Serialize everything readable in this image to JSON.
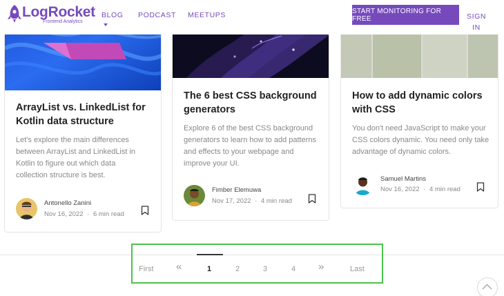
{
  "header": {
    "logo_text": "LogRocket",
    "logo_subtitle": "Frontend Analytics",
    "nav": [
      "BLOG",
      "PODCAST",
      "MEETUPS"
    ],
    "cta_label": "START MONITORING FOR FREE",
    "signin_line1": "SIGN",
    "signin_line2": "IN",
    "brand_color": "#764abc"
  },
  "cards": [
    {
      "title_line1": "ArrayList vs. LinkedList for",
      "title_line2": "Kotlin data structure",
      "desc": [
        "Let's explore the main differences",
        "between ArrayList and LinkedList in",
        "Kotlin to figure out which data",
        "collection structure is best."
      ],
      "author": "Antonello Zanini",
      "date": "Nov 16, 2022",
      "read_time": "6 min read"
    },
    {
      "title_line1": "The 6 best CSS background",
      "title_line2": "generators",
      "desc": [
        "Explore 6 of the best CSS background",
        "generators to learn how to add patterns",
        "and effects to your webpage and",
        "improve your UI."
      ],
      "author": "Fimber Elemuwa",
      "date": "Nov 17, 2022",
      "read_time": "4 min read"
    },
    {
      "title_line1": "How to add dynamic colors",
      "title_line2": "with CSS",
      "desc": [
        "You don't need JavaScript to make your",
        "CSS colors dynamic. You need only take",
        "advantage of dynamic colors."
      ],
      "author": "Samuel Martins",
      "date": "Nov 16, 2022",
      "read_time": "4 min read"
    }
  ],
  "separator": "·",
  "pagination": {
    "first": "First",
    "prev": "«",
    "pages": [
      "1",
      "2",
      "3",
      "4"
    ],
    "current": "1",
    "next": "»",
    "last": "Last",
    "highlight_color": "#4cc24c"
  }
}
